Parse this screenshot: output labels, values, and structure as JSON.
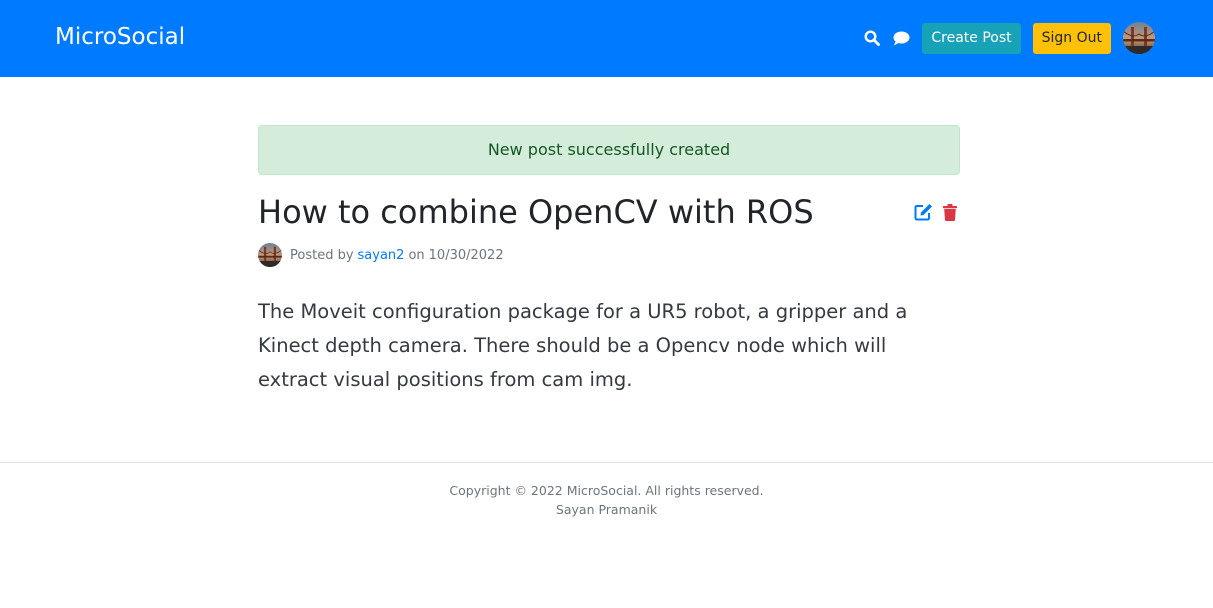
{
  "navbar": {
    "brand": "MicroSocial",
    "search_icon": "search-icon",
    "chat_icon": "chat-bubble-icon",
    "create_post_label": "Create Post",
    "sign_out_label": "Sign Out",
    "colors": {
      "navbar_bg": "#007bff",
      "create_post_bg": "#17a2b8",
      "sign_out_bg": "#ffc107"
    }
  },
  "alert": {
    "message": "New post successfully created"
  },
  "post": {
    "title": "How to combine OpenCV with ROS",
    "edit_icon": "edit-icon",
    "delete_icon": "trash-icon",
    "meta": {
      "posted_by": "Posted by",
      "author": "sayan2",
      "on": "on",
      "date": "10/30/2022"
    },
    "body": "The Moveit configuration package for a UR5 robot, a gripper and a Kinect depth camera. There should be a Opencv node which will extract visual positions from cam img."
  },
  "footer": {
    "copyright": "Copyright © 2022 MicroSocial. All rights reserved.",
    "author": "Sayan Pramanik"
  }
}
